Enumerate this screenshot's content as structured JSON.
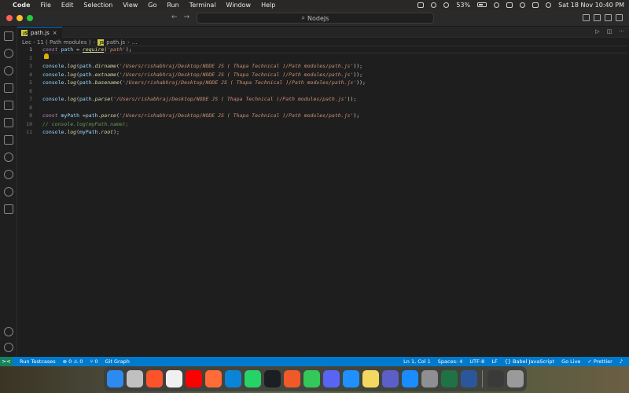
{
  "menubar": {
    "app_name": "Code",
    "items": [
      "File",
      "Edit",
      "Selection",
      "View",
      "Go",
      "Run",
      "Terminal",
      "Window",
      "Help"
    ],
    "battery_percent": "53%",
    "datetime": "Sat 18 Nov  10:40 PM"
  },
  "titlebar": {
    "search_text": "NodeJs"
  },
  "tab": {
    "label": "path.js",
    "icon_text": "JS",
    "close": "×"
  },
  "breadcrumb": {
    "folder": "Lec - 11 ( Path modules )",
    "file": "path.js",
    "symbol": "..."
  },
  "editor": {
    "line_numbers": [
      "1",
      "2",
      "3",
      "4",
      "5",
      "6",
      "7",
      "8",
      "9",
      "10",
      "11"
    ],
    "lines": [
      "const path = require('path');",
      "",
      "console.log(path.dirname('/Users/rishabhraj/Desktop/NODE JS ( Thapa Technical )/Path modules/path.js'));",
      "console.log(path.extname('/Users/rishabhraj/Desktop/NODE JS ( Thapa Technical )/Path modules/path.js'));",
      "console.log(path.basename('/Users/rishabhraj/Desktop/NODE JS ( Thapa Technical )/Path modules/path.js'));",
      "",
      "console.log(path.parse('/Users/rishabhraj/Desktop/NODE JS ( Thapa Technical )/Path modules/path.js'));",
      "",
      "const myPath =path.parse('/Users/rishabhraj/Desktop/NODE JS ( Thapa Technical )/Path modules/path.js');",
      "// console.log(myPath.name);",
      "console.log(myPath.root);"
    ]
  },
  "statusbar": {
    "remote_icon": "><",
    "run_testcases": "Run Testcases",
    "problems": "⊗ 0 ⚠ 0",
    "ports": "⑂ 0",
    "git_graph": "Git Graph",
    "cursor": "Ln 1, Col 1",
    "spaces": "Spaces: 4",
    "encoding": "UTF-8",
    "eol": "LF",
    "language": "{} Babel JavaScript",
    "go_live": "Go Live",
    "prettier": "✓ Prettier"
  },
  "dock": {
    "apps": [
      {
        "name": "finder-icon",
        "color": "#2d8bf0"
      },
      {
        "name": "launchpad-icon",
        "color": "#c0c0c0"
      },
      {
        "name": "brave-icon",
        "color": "#fb542b"
      },
      {
        "name": "chrome-icon",
        "color": "#f0f0f0"
      },
      {
        "name": "youtube-icon",
        "color": "#ff0000"
      },
      {
        "name": "postman-icon",
        "color": "#ff6c37"
      },
      {
        "name": "vscode-icon",
        "color": "#0a84d6"
      },
      {
        "name": "whatsapp-icon",
        "color": "#25d366"
      },
      {
        "name": "github-icon",
        "color": "#1b1f23"
      },
      {
        "name": "infuse-icon",
        "color": "#f05a28"
      },
      {
        "name": "messages-icon",
        "color": "#34c759"
      },
      {
        "name": "discord-icon",
        "color": "#5865f2"
      },
      {
        "name": "mail-icon",
        "color": "#1e90ff"
      },
      {
        "name": "notes-icon",
        "color": "#f2d860"
      },
      {
        "name": "teams-icon",
        "color": "#5b5fc7"
      },
      {
        "name": "app-store-icon",
        "color": "#1a8cff"
      },
      {
        "name": "system-settings-icon",
        "color": "#8e8e93"
      },
      {
        "name": "excel-icon",
        "color": "#1f7244"
      },
      {
        "name": "word-icon",
        "color": "#2b579a"
      },
      {
        "name": "downloads-icon",
        "color": "#3a3a3a"
      },
      {
        "name": "trash-icon",
        "color": "#9a9a9a"
      }
    ]
  },
  "colors": {
    "accent": "#007acc",
    "editor_bg": "#1e1e1e"
  }
}
